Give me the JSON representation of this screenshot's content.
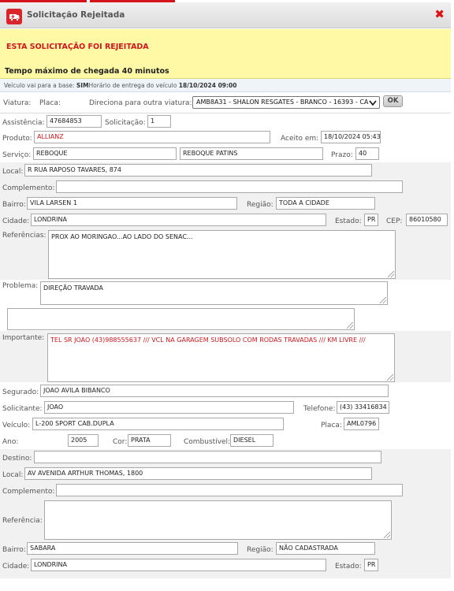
{
  "window": {
    "title": "Solicitação Rejeitada",
    "icon_name": "ambulance-logo-icon",
    "close_icon": "close-icon",
    "accent": "#d9262c"
  },
  "alert": {
    "title": "ESTA SOLICITAÇÃO FOI REJEITADA",
    "max_time": "Tempo máximo de chegada 40 minutos"
  },
  "info": {
    "base_label": "Veículo vai para a base: ",
    "base_value": "SIM",
    "delivery_label": "Horário de entrega do veículo ",
    "delivery_value": "18/10/2024 09:00"
  },
  "viatura": {
    "viatura_label": "Viatura:",
    "placa_label": "Placa:",
    "redirect_label": "Direciona para outra viatura:",
    "select_value": "AMB8A31 - SHALON RESGATES - BRANCO - 16393 - CA",
    "ok_label": "OK"
  },
  "request": {
    "assistencia_label": "Assistência:",
    "assistencia_value": "47684853",
    "solicitacao_label": "Solicitação:",
    "solicitacao_value": "1",
    "produto_label": "Produto:",
    "produto_value": "ALLIANZ",
    "aceito_label": "Aceito em:",
    "aceito_value": "18/10/2024 05:43",
    "servico_label": "Serviço:",
    "servico_value": "REBOQUE",
    "servico_value2": "REBOQUE PATINS",
    "prazo_label": "Prazo:",
    "prazo_value": "40"
  },
  "origin": {
    "local_label": "Local:",
    "local_value": "R RUA RAPOSO TAVARES, 874",
    "complemento_label": "Complemento:",
    "complemento_value": "",
    "bairro_label": "Bairro:",
    "bairro_value": "VILA LARSEN 1",
    "regiao_label": "Região:",
    "regiao_value": "TODA A CIDADE",
    "cidade_label": "Cidade:",
    "cidade_value": "LONDRINA",
    "estado_label": "Estado:",
    "estado_value": "PR",
    "cep_label": "CEP:",
    "cep_value": "86010580",
    "referencias_label": "Referências:",
    "referencias_value": "PROX AO MORINGAO...AO LADO DO SENAC..."
  },
  "problem": {
    "problema_label": "Problema:",
    "problema_value": "DIREÇÃO TRAVADA",
    "extra_value": "",
    "importante_label": "Importante:",
    "importante_value": "TEL SR JOAO (43)988555637 /// VCL NA GARAGEM SUBSOLO COM RODAS TRAVADAS ///  KM LIVRE ///"
  },
  "insured": {
    "segurado_label": "Segurado:",
    "segurado_value": "JOAO AVILA BIBANCO",
    "solicitante_label": "Solicitante:",
    "solicitante_value": "JOAO",
    "telefone_label": "Telefone:",
    "telefone_value": "(43) 33416834",
    "veiculo_label": "Veículo:",
    "veiculo_value": "L-200 SPORT CAB.DUPLA",
    "placa_label": "Placa:",
    "placa_value": "AML0796",
    "ano_label": "Ano:",
    "ano_value": "2005",
    "cor_label": "Cor:",
    "cor_value": "PRATA",
    "combustivel_label": "Combustível:",
    "combustivel_value": "DIESEL"
  },
  "destination": {
    "destino_label": "Destino:",
    "destino_value": "",
    "local_label": "Local:",
    "local_value": "AV AVENIDA ARTHUR THOMAS, 1800",
    "complemento_label": "Complemento:",
    "complemento_value": "",
    "referencia_label": "Referência:",
    "referencia_value": "",
    "bairro_label": "Bairro:",
    "bairro_value": "SABARA",
    "regiao_label": "Região:",
    "regiao_value": "NÃO CADASTRADA",
    "cidade_label": "Cidade:",
    "cidade_value": "LONDRINA",
    "estado_label": "Estado:",
    "estado_value": "PR"
  }
}
